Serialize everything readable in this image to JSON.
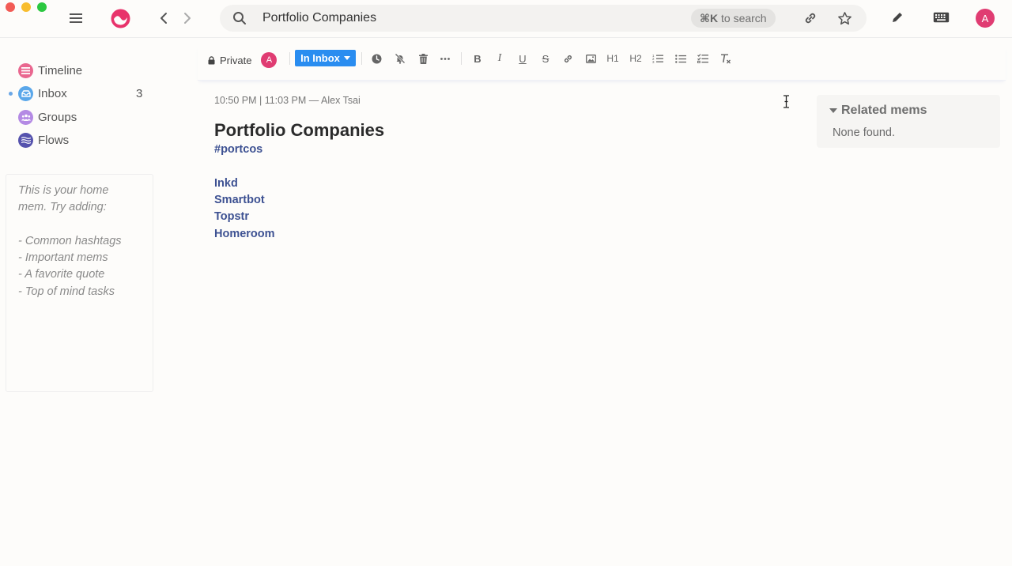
{
  "search": {
    "value": "Portfolio Companies",
    "shortcut": "⌘K",
    "shortcut_suffix": " to search"
  },
  "user": {
    "initial": "A",
    "color": "#e03c72"
  },
  "sidebar": {
    "items": [
      {
        "label": "Timeline",
        "icon": "timeline-icon",
        "color": "#e9678f",
        "count": ""
      },
      {
        "label": "Inbox",
        "icon": "inbox-icon",
        "color": "#5aa7ea",
        "count": "3"
      },
      {
        "label": "Groups",
        "icon": "groups-icon",
        "color": "#b48ae4",
        "count": ""
      },
      {
        "label": "Flows",
        "icon": "flows-icon",
        "color": "#5552ad",
        "count": ""
      }
    ],
    "home_card_text": "This is your home\nmem. Try adding:\n\n- Common hashtags\n- Important mems\n- A favorite quote\n- Top of mind tasks"
  },
  "toolbar": {
    "privacy_label": "Private",
    "inbox_label": "In Inbox",
    "formatting_icons": [
      "clock-icon",
      "snooze-off-icon",
      "trash-icon",
      "more-icon",
      "bold-icon",
      "italic-icon",
      "underline-icon",
      "strikethrough-icon",
      "link-icon",
      "image-icon",
      "heading-1-icon",
      "heading-2-icon",
      "ordered-list-icon",
      "bullet-list-icon",
      "checklist-icon",
      "clear-format-icon"
    ],
    "bold": "B",
    "italic": "I",
    "underline": "U",
    "strike": "S",
    "h1": "H1",
    "h2": "H2"
  },
  "mem": {
    "meta": "10:50 PM | 11:03 PM — Alex Tsai",
    "title": "Portfolio Companies",
    "tag": "#portcos",
    "companies": [
      "Inkd",
      "Smartbot",
      "Topstr",
      "Homeroom"
    ]
  },
  "related": {
    "heading": "Related mems",
    "empty_text": "None found."
  },
  "colors": {
    "accent_blue": "#2a8df0",
    "link_blue": "#3d5192",
    "brand_pink": "#e8336b"
  }
}
